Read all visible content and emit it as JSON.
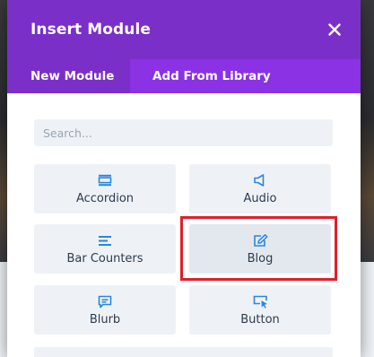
{
  "dialog": {
    "title": "Insert Module",
    "close_icon": "close-icon"
  },
  "tabs": [
    {
      "label": "New Module",
      "active": true
    },
    {
      "label": "Add From Library",
      "active": false
    }
  ],
  "search": {
    "placeholder": "Search...",
    "value": ""
  },
  "modules": [
    {
      "label": "Accordion",
      "icon": "accordion-icon"
    },
    {
      "label": "Audio",
      "icon": "audio-icon"
    },
    {
      "label": "Bar Counters",
      "icon": "bar-counters-icon"
    },
    {
      "label": "Blog",
      "icon": "blog-icon",
      "highlighted": true
    },
    {
      "label": "Blurb",
      "icon": "blurb-icon"
    },
    {
      "label": "Button",
      "icon": "button-icon"
    }
  ],
  "colors": {
    "header": "#7b2fc9",
    "tabs": "#8a2be2",
    "icon": "#2b87da",
    "highlight": "#e01f2a"
  }
}
